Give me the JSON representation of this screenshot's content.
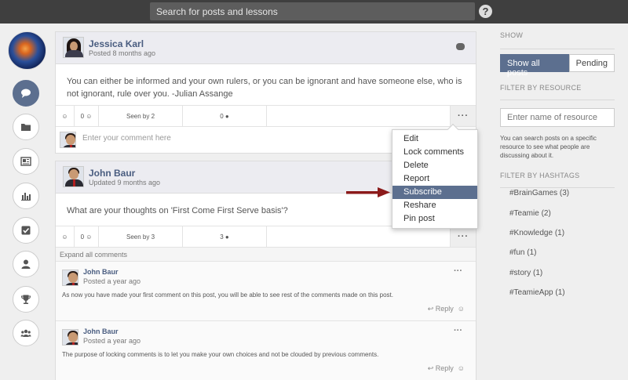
{
  "topbar": {
    "search_placeholder": "Search for posts and lessons",
    "help_label": "?"
  },
  "nav": {
    "items": [
      "chat-icon",
      "folder-icon",
      "newspaper-icon",
      "bar-chart-icon",
      "checkbox-icon",
      "user-icon",
      "trophy-icon",
      "group-icon"
    ],
    "active": "chat-icon"
  },
  "posts": [
    {
      "author": "Jessica Karl",
      "time": "Posted 8 months ago",
      "body": "You can either be informed and your own rulers, or you can be ignorant and have someone else, who is not ignorant, rule over you. -Julian Assange",
      "likes": "0",
      "seen": "Seen by 2",
      "comments": "0",
      "more": "···"
    },
    {
      "author": "John Baur",
      "time": "Updated 9 months ago",
      "body": "What are your thoughts on 'First Come First Serve basis'?",
      "likes": "0",
      "seen": "Seen by 3",
      "comments": "3",
      "more": "···"
    }
  ],
  "comment_placeholder": "Enter your comment here",
  "expand_label": "Expand all comments",
  "comments": [
    {
      "author": "John Baur",
      "time": "Posted a year ago",
      "text": "As now you have made your first comment on this post, you will be able to see rest of the comments made on this post.",
      "reply": "Reply",
      "more": "···"
    },
    {
      "author": "John Baur",
      "time": "Posted a year ago",
      "text": "The purpose of locking comments is to let you make your own choices and not be clouded by previous comments.",
      "reply": "Reply",
      "more": "···"
    }
  ],
  "menu": {
    "items": [
      "Edit",
      "Lock comments",
      "Delete",
      "Report",
      "Subscribe",
      "Reshare",
      "Pin post"
    ],
    "highlighted": "Subscribe"
  },
  "sidebar": {
    "show_title": "SHOW",
    "show_all": "Show all posts",
    "pending": "Pending",
    "resource_title": "FILTER BY RESOURCE",
    "resource_placeholder": "Enter name of resource",
    "resource_help": "You can search posts on a specific resource to see what people are discussing about it.",
    "hashtag_title": "FILTER BY HASHTAGS",
    "hashtags": [
      "#BrainGames (3)",
      "#Teamie (2)",
      "#Knowledge (1)",
      "#fun (1)",
      "#story (1)",
      "#TeamieApp (1)"
    ]
  },
  "colors": {
    "accent": "#5c6f8f",
    "topbar": "#3f3f3f",
    "arrow": "#8b1a1a"
  }
}
